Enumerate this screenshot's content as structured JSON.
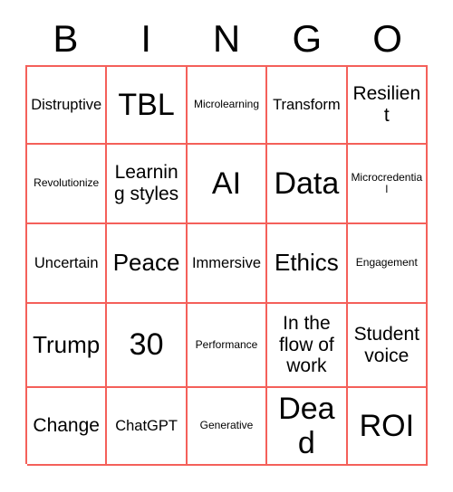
{
  "header": {
    "letters": [
      "B",
      "I",
      "N",
      "G",
      "O"
    ]
  },
  "grid": {
    "columns": 5,
    "rows": 5,
    "border_color": "#f4605a",
    "text_color": "#000000",
    "background_color": "#ffffff",
    "cells": [
      {
        "text": "Distruptive",
        "size": "sz-s"
      },
      {
        "text": "TBL",
        "size": "sz-xl"
      },
      {
        "text": "Microlearning",
        "size": "sz-xs"
      },
      {
        "text": "Transform",
        "size": "sz-s"
      },
      {
        "text": "Resilient",
        "size": "sz-m"
      },
      {
        "text": "Revolutionize",
        "size": "sz-xs"
      },
      {
        "text": "Learning styles",
        "size": "sz-m"
      },
      {
        "text": "AI",
        "size": "sz-xl"
      },
      {
        "text": "Data",
        "size": "sz-xl"
      },
      {
        "text": "Microcredential",
        "size": "sz-xs"
      },
      {
        "text": "Uncertain",
        "size": "sz-s"
      },
      {
        "text": "Peace",
        "size": "sz-l"
      },
      {
        "text": "Immersive",
        "size": "sz-s"
      },
      {
        "text": "Ethics",
        "size": "sz-l"
      },
      {
        "text": "Engagement",
        "size": "sz-xs"
      },
      {
        "text": "Trump",
        "size": "sz-l"
      },
      {
        "text": "30",
        "size": "sz-xl"
      },
      {
        "text": "Performance",
        "size": "sz-xs"
      },
      {
        "text": "In the flow of work",
        "size": "sz-m"
      },
      {
        "text": "Student voice",
        "size": "sz-m"
      },
      {
        "text": "Change",
        "size": "sz-m"
      },
      {
        "text": "ChatGPT",
        "size": "sz-s"
      },
      {
        "text": "Generative",
        "size": "sz-xs"
      },
      {
        "text": "Dead",
        "size": "sz-xl"
      },
      {
        "text": "ROI",
        "size": "sz-xl"
      }
    ]
  }
}
